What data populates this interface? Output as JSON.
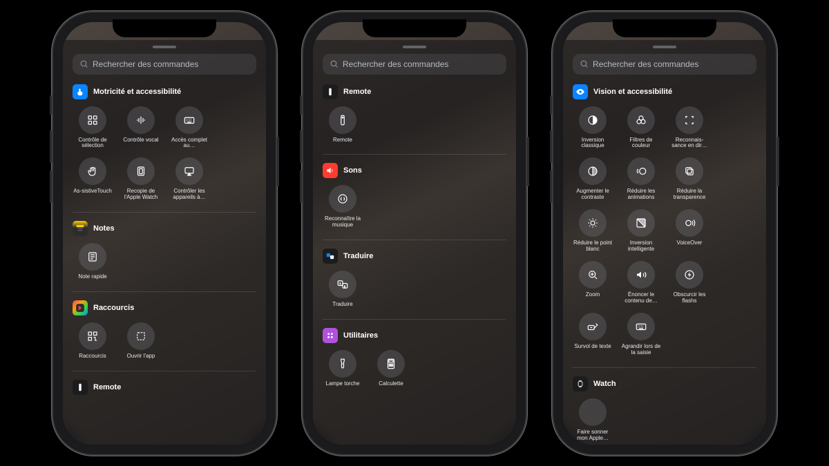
{
  "search_placeholder": "Rechercher des commandes",
  "phones": [
    {
      "sections": [
        {
          "title": "Motricité et accessibilité",
          "icon": "touch-icon",
          "icon_bg": "#0a84ff",
          "items": [
            {
              "icon": "grid4",
              "label": "Contrôle de sélection"
            },
            {
              "icon": "voice",
              "label": "Contrôle vocal"
            },
            {
              "icon": "keyboard",
              "label": "Accès complet au…"
            },
            {
              "icon": "hand",
              "label": "As-sistiveTouch"
            },
            {
              "icon": "mirror",
              "label": "Recopie de l'Apple Watch"
            },
            {
              "icon": "airplay",
              "label": "Contrôler les appareils à…"
            }
          ]
        },
        {
          "title": "Notes",
          "icon": "notes-icon",
          "icon_bg": "linear-gradient(#ffcc00,#2c2c2e 45%)",
          "items": [
            {
              "icon": "note",
              "label": "Note rapide"
            }
          ]
        },
        {
          "title": "Raccourcis",
          "icon": "shortcuts-icon",
          "icon_bg": "linear-gradient(135deg,#ff375f,#ff9f0a,#32d74b,#0a84ff)",
          "items": [
            {
              "icon": "qr",
              "label": "Raccourcis"
            },
            {
              "icon": "dashedsq",
              "label": "Ouvrir l'app"
            }
          ]
        },
        {
          "title": "Remote",
          "icon": "remote-icon",
          "icon_bg": "#1c1c1e",
          "items": []
        }
      ]
    },
    {
      "sections": [
        {
          "title": "Remote",
          "icon": "remote-icon",
          "icon_bg": "#1c1c1e",
          "items": [
            {
              "icon": "remote",
              "label": "Remote"
            }
          ]
        },
        {
          "title": "Sons",
          "icon": "sounds-icon",
          "icon_bg": "#ff3b30",
          "items": [
            {
              "icon": "shazam",
              "label": "Reconnaître la musique"
            }
          ]
        },
        {
          "title": "Traduire",
          "icon": "translate-icon",
          "icon_bg": "#1c1c1e",
          "items": [
            {
              "icon": "translate",
              "label": "Traduire"
            }
          ]
        },
        {
          "title": "Utilitaires",
          "icon": "utilities-icon",
          "icon_bg": "#af52de",
          "items": [
            {
              "icon": "torch",
              "label": "Lampe torche"
            },
            {
              "icon": "calc",
              "label": "Calculette"
            }
          ]
        }
      ]
    },
    {
      "sections": [
        {
          "title": "Vision et accessibilité",
          "icon": "eye-icon",
          "icon_bg": "#0a84ff",
          "items": [
            {
              "icon": "halfcircle",
              "label": "Inversion classique"
            },
            {
              "icon": "threecircles",
              "label": "Filtres de couleur"
            },
            {
              "icon": "corners",
              "label": "Reconnais-sance en dir…"
            },
            {
              "icon": "contrast",
              "label": "Augmenter le contraste"
            },
            {
              "icon": "motion",
              "label": "Réduire les animations"
            },
            {
              "icon": "stacksq",
              "label": "Réduire la transparence"
            },
            {
              "icon": "sun",
              "label": "Réduire le point blanc"
            },
            {
              "icon": "smartinv",
              "label": "Inversion intelligente"
            },
            {
              "icon": "voiceover",
              "label": "VoiceOver"
            },
            {
              "icon": "zoom",
              "label": "Zoom"
            },
            {
              "icon": "speaker",
              "label": "Énoncer le contenu de…"
            },
            {
              "icon": "flash",
              "label": "Obscurcir les flashs"
            },
            {
              "icon": "hovertext",
              "label": "Survol de texte"
            },
            {
              "icon": "keyboard",
              "label": "Agrandir lors de la saisie"
            }
          ]
        },
        {
          "title": "Watch",
          "icon": "watch-icon",
          "icon_bg": "#1c1c1e",
          "items": [
            {
              "icon": "blank",
              "label": "Faire sonner mon Apple…"
            }
          ]
        }
      ]
    }
  ]
}
